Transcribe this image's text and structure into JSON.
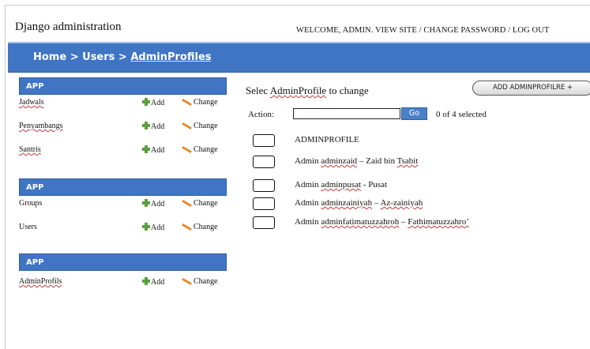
{
  "header": {
    "site_title": "Django administration",
    "user_tools": "WELCOME, ADMIN. VIEW SITE / CHANGE PASSWORD / LOG OUT"
  },
  "breadcrumb": {
    "home": "Home",
    "sep1": " > ",
    "users": "Users",
    "sep2": " > ",
    "current": "AdminProfiles"
  },
  "sidebar": {
    "modules": [
      {
        "header": "APP",
        "rows": [
          {
            "label": "Jadwals",
            "add": "Add",
            "change": "Change"
          },
          {
            "label": "Penyambangs",
            "add": "Add",
            "change": "Change"
          },
          {
            "label": "Santris",
            "add": "Add",
            "change": "Change"
          }
        ]
      },
      {
        "header": "APP",
        "rows": [
          {
            "label": "Groups",
            "add": "Add",
            "change": "Change"
          },
          {
            "label": "Users",
            "add": "Add",
            "change": "Change"
          }
        ]
      },
      {
        "header": "APP",
        "rows": [
          {
            "label": "AdminProfils",
            "add": "Add",
            "change": "Change"
          }
        ]
      }
    ]
  },
  "content": {
    "title_prefix": "Selec ",
    "title_model": "AdminProfile",
    "title_suffix": " to change",
    "add_button": "ADD ADMINPROFILRE +",
    "action_label": "Action:",
    "go_button": "Go",
    "selected_count": "0 of 4 selected",
    "column_header": "ADMINPROFILE",
    "rows": [
      {
        "prefix": "Admin ",
        "username": "adminzaid",
        "rest": " – Zaid bin ",
        "extra": "Tsabit"
      },
      {
        "prefix": "Admin ",
        "username": "adminpusat",
        "rest": " - Pusat",
        "extra": ""
      },
      {
        "prefix": "Admin ",
        "username": "adminzainiyah",
        "rest": " – ",
        "extra": "Az-zainiyah"
      },
      {
        "prefix": "Admin ",
        "username": "adminfatimatuzzahroh",
        "rest": " – ",
        "extra": "Fathimatuzzahro’"
      }
    ]
  }
}
